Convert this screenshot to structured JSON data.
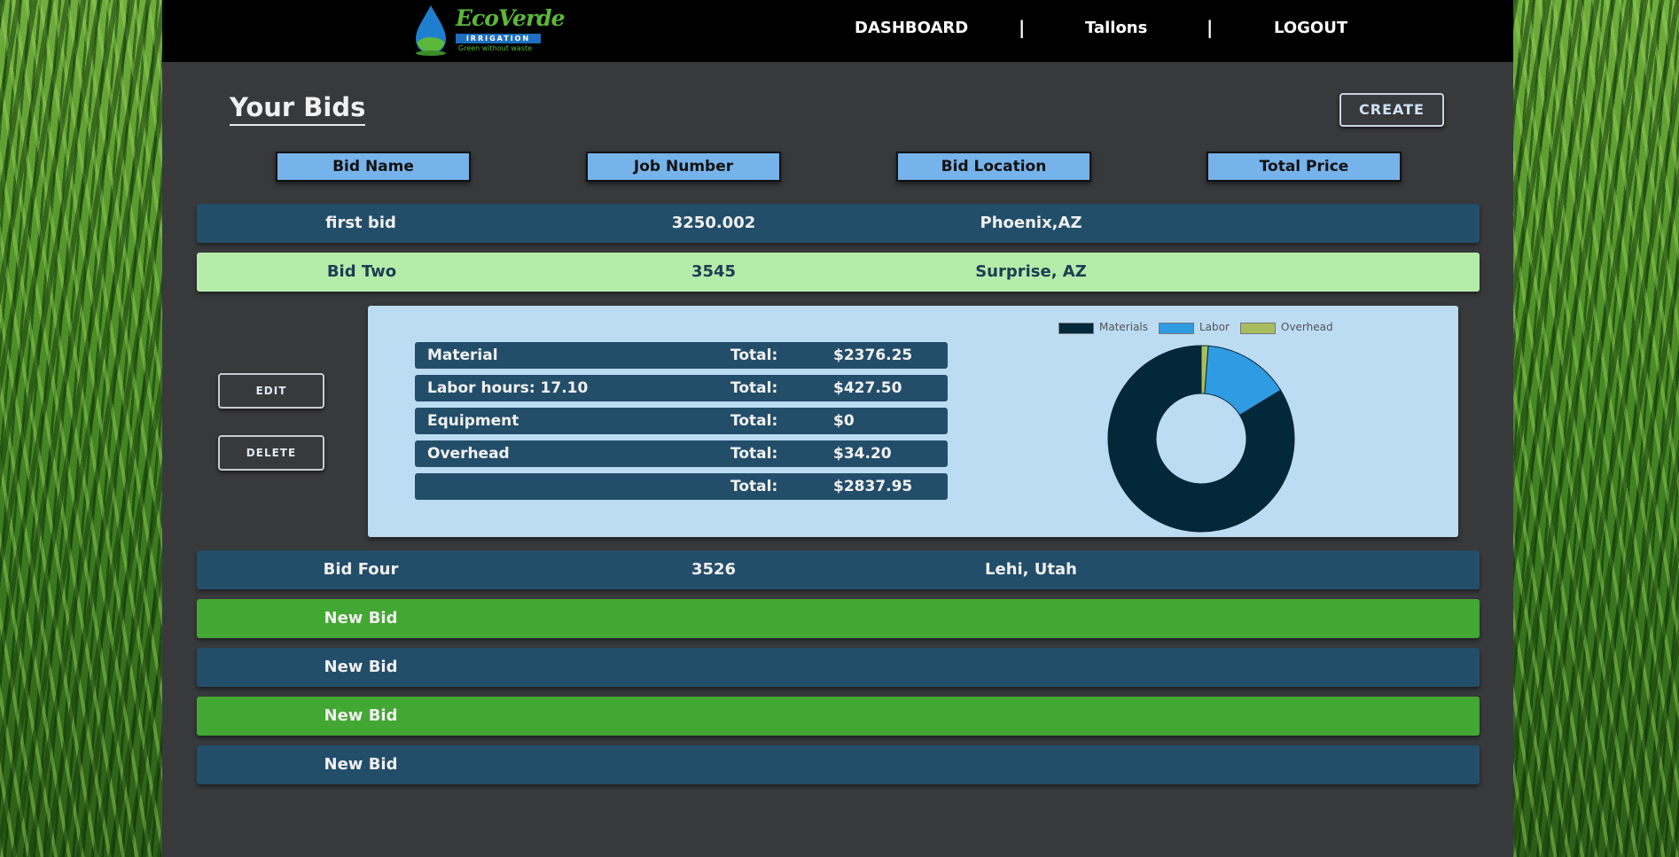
{
  "header": {
    "logo": {
      "brand": "EcoVerde",
      "sub": "IRRIGATION",
      "tagline": "Green without waste"
    },
    "nav": {
      "dashboard": "DASHBOARD",
      "user": "Tallons",
      "logout": "LOGOUT",
      "separator": "|"
    }
  },
  "page": {
    "title": "Your Bids",
    "create_label": "CREATE"
  },
  "columns": [
    "Bid Name",
    "Job Number",
    "Bid Location",
    "Total Price"
  ],
  "bids": [
    {
      "name": "first bid",
      "job": "3250.002",
      "location": "Phoenix,AZ"
    },
    {
      "name": "Bid Two",
      "job": "3545",
      "location": "Surprise, AZ"
    },
    {
      "name": "Bid Four",
      "job": "3526",
      "location": "Lehi, Utah"
    },
    {
      "name": "New Bid",
      "job": "",
      "location": ""
    },
    {
      "name": "New Bid",
      "job": "",
      "location": ""
    },
    {
      "name": "New Bid",
      "job": "",
      "location": ""
    },
    {
      "name": "New Bid",
      "job": "",
      "location": ""
    }
  ],
  "detail": {
    "edit_label": "EDIT",
    "delete_label": "DELETE",
    "rows": [
      {
        "label": "Material",
        "total_label": "Total:",
        "value": "$2376.25"
      },
      {
        "label": "Labor hours: 17.10",
        "total_label": "Total:",
        "value": "$427.50"
      },
      {
        "label": "Equipment",
        "total_label": "Total:",
        "value": "$0"
      },
      {
        "label": "Overhead",
        "total_label": "Total:",
        "value": "$34.20"
      },
      {
        "label": "",
        "total_label": "Total:",
        "value": "$2837.95"
      }
    ]
  },
  "colors": {
    "row_blue": "#234e6a",
    "row_selected": "#b4ecaa",
    "row_green": "#43a733",
    "header_cell": "#76b3ea",
    "detail_bg": "#bcdcf4"
  },
  "chart_data": {
    "type": "pie",
    "donut": true,
    "legend_position": "top",
    "categories": [
      "Materials",
      "Labor",
      "Overhead"
    ],
    "values": [
      2376.25,
      427.5,
      34.2
    ],
    "colors": [
      "#03283a",
      "#2f9be3",
      "#a9bd60"
    ]
  }
}
